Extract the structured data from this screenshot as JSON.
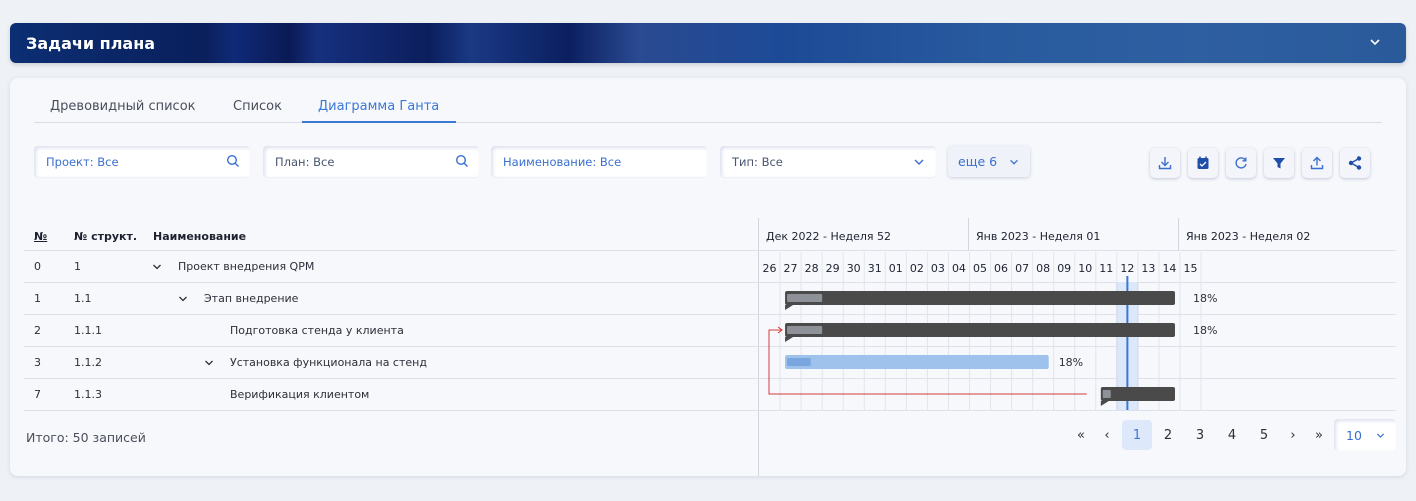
{
  "header": {
    "title": "Задачи плана",
    "chevron_icon": "chevron-down-icon"
  },
  "tabs": [
    {
      "label": "Древовидный список",
      "active": false
    },
    {
      "label": "Список",
      "active": false
    },
    {
      "label": "Диаграмма Ганта",
      "active": true
    }
  ],
  "filters": {
    "project": {
      "label": "Проект:",
      "value": "Все",
      "icon": "search-icon"
    },
    "plan": {
      "label": "План:",
      "value": "Все",
      "icon": "search-icon"
    },
    "name": {
      "label": "Наименование:",
      "value": "Все"
    },
    "type": {
      "label": "Тип:",
      "value": "Все",
      "icon": "chevron-down-icon"
    },
    "more": {
      "label": "еще 6"
    }
  },
  "toolbar": [
    "download-icon",
    "calendar-icon",
    "refresh-icon",
    "filter-icon",
    "upload-icon",
    "share-icon"
  ],
  "table": {
    "headers": {
      "num": "№",
      "struct": "№ структ.",
      "name": "Наименование"
    },
    "rows": [
      {
        "num": "0",
        "struct": "1",
        "name": "Проект внедрения QPM",
        "expanded": true,
        "level": 0
      },
      {
        "num": "1",
        "struct": "1.1",
        "name": "Этап внедрение",
        "expanded": true,
        "level": 1
      },
      {
        "num": "2",
        "struct": "1.1.1",
        "name": "Подготовка стенда у клиента",
        "expanded": null,
        "level": 2
      },
      {
        "num": "3",
        "struct": "1.1.2",
        "name": "Установка функционала на стенд",
        "expanded": true,
        "level": 2
      },
      {
        "num": "7",
        "struct": "1.1.3",
        "name": "Верификация клиентом",
        "expanded": null,
        "level": 2
      }
    ]
  },
  "gantt": {
    "weeks": [
      "Дек 2022 - Неделя 52",
      "Янв 2023 - Неделя 01",
      "Янв 2023 - Неделя 02"
    ],
    "days": [
      "26",
      "27",
      "28",
      "29",
      "30",
      "31",
      "01",
      "02",
      "03",
      "04",
      "05",
      "06",
      "07",
      "08",
      "09",
      "10",
      "11",
      "12",
      "13",
      "14",
      "15"
    ],
    "today": "12",
    "tasks": [
      {
        "row": 1,
        "start": "27",
        "end": "14",
        "progress": 0.18,
        "percent": "18%",
        "style": "dark"
      },
      {
        "row": 2,
        "start": "27",
        "end": "14",
        "progress": 0.18,
        "percent": "18%",
        "style": "dark"
      },
      {
        "row": 3,
        "start": "27",
        "end": "08",
        "progress": 0.18,
        "percent": "18%",
        "style": "light"
      },
      {
        "row": 4,
        "start": "11",
        "end": "14",
        "progress": 0.18,
        "percent": "",
        "style": "dark"
      }
    ],
    "link_color": "#d33b3b",
    "today_color": "#3a78d8"
  },
  "footer": {
    "total": "Итого: 50 записей",
    "pages": [
      "1",
      "2",
      "3",
      "4",
      "5"
    ],
    "current_page": "1",
    "first": "«",
    "prev": "‹",
    "next": "›",
    "last": "»",
    "page_size": "10"
  }
}
